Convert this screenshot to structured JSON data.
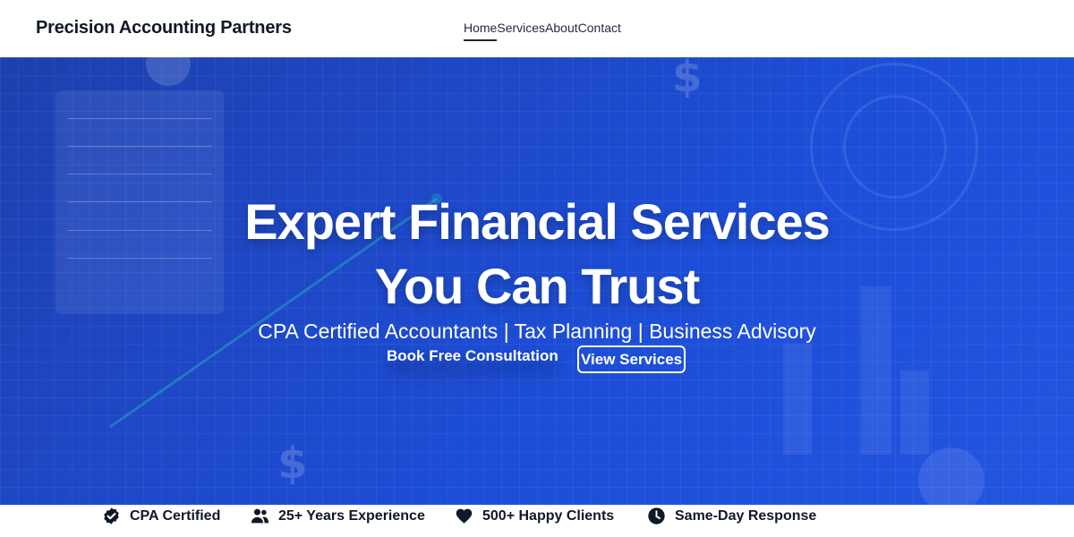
{
  "header": {
    "brand": "Precision Accounting Partners",
    "nav": [
      "Home",
      "Services",
      "About",
      "Contact"
    ],
    "active_nav": "Home"
  },
  "hero": {
    "title_line1": "Expert Financial Services",
    "title_line2": "You Can Trust",
    "subtitle": "CPA Certified Accountants | Tax Planning | Business Advisory",
    "primary_cta": "Book Free Consultation",
    "secondary_cta": "View Services",
    "decor_symbol": "$"
  },
  "trust": [
    {
      "icon": "badge-check-icon",
      "label": "CPA Certified"
    },
    {
      "icon": "users-icon",
      "label": "25+ Years Experience"
    },
    {
      "icon": "heart-icon",
      "label": "500+ Happy Clients"
    },
    {
      "icon": "clock-icon",
      "label": "Same-Day Response"
    }
  ],
  "colors": {
    "hero_bg": "#1d4ed8",
    "text_dark": "#111827",
    "white": "#ffffff"
  }
}
